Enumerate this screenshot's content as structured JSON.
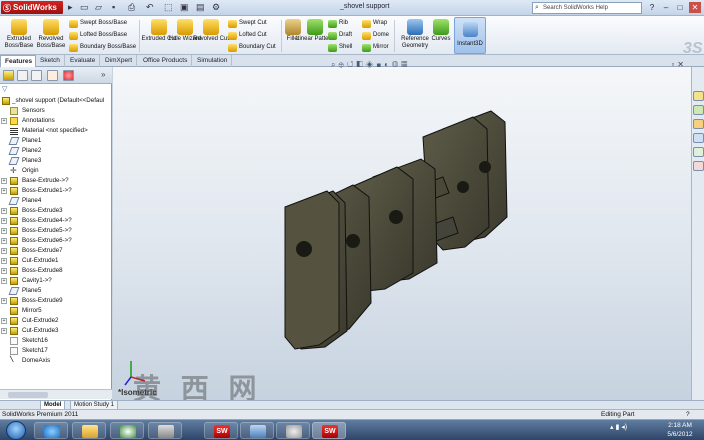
{
  "window": {
    "app_name": "SolidWorks",
    "document_title": "_shovel support",
    "help_search_placeholder": "Search SolidWorks Help",
    "min": "–",
    "max": "□",
    "close": "✕"
  },
  "commands": {
    "extruded_boss": "Extruded Boss/Base",
    "revolved_boss": "Revolved Boss/Base",
    "swept_boss": "Swept Boss/Base",
    "lofted_boss": "Lofted Boss/Base",
    "boundary_boss": "Boundary Boss/Base",
    "extruded_cut": "Extruded Cut",
    "hole_wizard": "Hole Wizard",
    "revolved_cut": "Revolved Cut",
    "swept_cut": "Swept Cut",
    "lofted_cut": "Lofted Cut",
    "boundary_cut": "Boundary Cut",
    "fillet": "Fillet",
    "linear_pattern": "Linear Pattern",
    "rib": "Rib",
    "draft": "Draft",
    "shell": "Shell",
    "wrap": "Wrap",
    "dome": "Dome",
    "mirror": "Mirror",
    "reference_geometry": "Reference Geometry",
    "curves": "Curves",
    "instant3d": "Instant3D"
  },
  "tabs": [
    "Features",
    "Sketch",
    "Evaluate",
    "DimXpert",
    "Office Products",
    "Simulation"
  ],
  "tree": {
    "root": "_shovel support  (Default<<Defaul",
    "items": [
      {
        "label": "Sensors",
        "icon": "sensors-icon",
        "exp": false
      },
      {
        "label": "Annotations",
        "icon": "annotations-icon",
        "exp": true
      },
      {
        "label": "Material <not specified>",
        "icon": "material-icon",
        "exp": false
      },
      {
        "label": "Plane1",
        "icon": "plane-icon",
        "exp": false
      },
      {
        "label": "Plane2",
        "icon": "plane-icon",
        "exp": false
      },
      {
        "label": "Plane3",
        "icon": "plane-icon",
        "exp": false
      },
      {
        "label": "Origin",
        "icon": "origin-icon",
        "exp": false
      },
      {
        "label": "Base-Extrude->?",
        "icon": "feature-icon",
        "exp": true
      },
      {
        "label": "Boss-Extrude1->?",
        "icon": "feature-icon",
        "exp": true
      },
      {
        "label": "Plane4",
        "icon": "plane-icon",
        "exp": false
      },
      {
        "label": "Boss-Extrude3",
        "icon": "feature-icon",
        "exp": true
      },
      {
        "label": "Boss-Extrude4->?",
        "icon": "feature-icon",
        "exp": true
      },
      {
        "label": "Boss-Extrude5->?",
        "icon": "feature-icon",
        "exp": true
      },
      {
        "label": "Boss-Extrude6->?",
        "icon": "feature-icon",
        "exp": true
      },
      {
        "label": "Boss-Extrude7",
        "icon": "feature-icon",
        "exp": true
      },
      {
        "label": "Cut-Extrude1",
        "icon": "feature-icon",
        "exp": true
      },
      {
        "label": "Boss-Extrude8",
        "icon": "feature-icon",
        "exp": true
      },
      {
        "label": "Cavity1->?",
        "icon": "feature-icon",
        "exp": true
      },
      {
        "label": "Plane5",
        "icon": "plane-icon",
        "exp": false
      },
      {
        "label": "Boss-Extrude9",
        "icon": "feature-icon",
        "exp": true
      },
      {
        "label": "Mirror5",
        "icon": "mirror-icon",
        "exp": false
      },
      {
        "label": "Cut-Extrude2",
        "icon": "feature-icon",
        "exp": true
      },
      {
        "label": "Cut-Extrude3",
        "icon": "feature-icon",
        "exp": true
      },
      {
        "label": "Sketch16",
        "icon": "sketch-icon",
        "exp": false
      },
      {
        "label": "Sketch17",
        "icon": "sketch-icon",
        "exp": false
      },
      {
        "label": "DomeAxis",
        "icon": "axis-icon",
        "exp": false
      }
    ]
  },
  "viewport": {
    "view_label": "*Isometric",
    "watermark": "黄 西 网"
  },
  "bottom_tabs": [
    "Model",
    "Motion Study 1"
  ],
  "status": {
    "left": "SolidWorks Premium 2011",
    "right": "Editing Part"
  },
  "clock": {
    "time": "2:18 AM",
    "date": "5/6/2012"
  },
  "colors": {
    "part": "#4b4a3a",
    "part_edge": "#111111",
    "accent": "#d8231f"
  }
}
